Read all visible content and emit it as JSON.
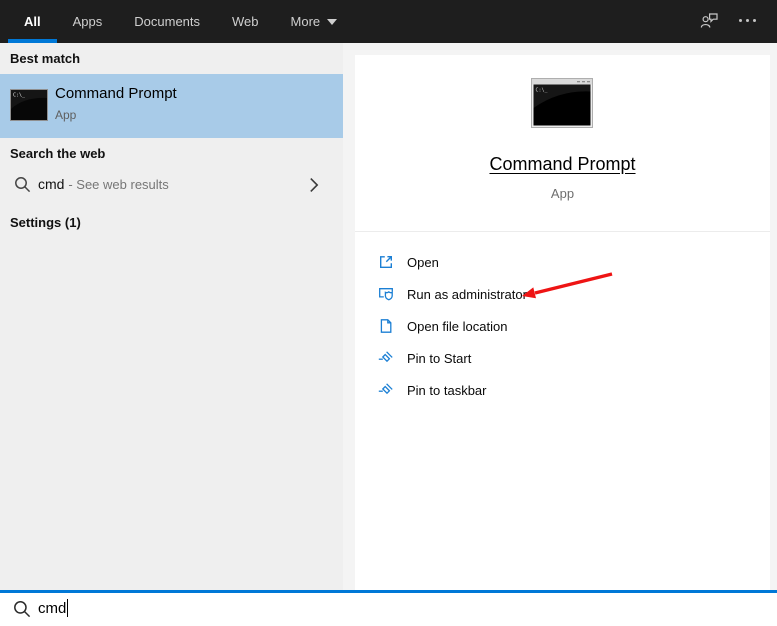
{
  "topbar": {
    "tabs": [
      {
        "label": "All",
        "active": true
      },
      {
        "label": "Apps",
        "active": false
      },
      {
        "label": "Documents",
        "active": false
      },
      {
        "label": "Web",
        "active": false
      },
      {
        "label": "More",
        "active": false,
        "has_dropdown": true
      }
    ],
    "icons": {
      "feedback": "person-chat-icon",
      "more_options": "ellipsis-icon"
    }
  },
  "left_panel": {
    "best_match": {
      "header": "Best match",
      "item": {
        "title": "Command Prompt",
        "subtitle": "App",
        "icon": "command-prompt-icon"
      }
    },
    "search_web": {
      "header": "Search the web",
      "item": {
        "query": "cmd",
        "suffix": "- See web results",
        "icon": "magnifier-icon",
        "chevron": "chevron-right-icon"
      }
    },
    "settings": {
      "header": "Settings (1)"
    }
  },
  "preview": {
    "icon": "command-prompt-window-icon",
    "icon_prompt_text": "C:\\_",
    "title": "Command Prompt",
    "subtitle": "App",
    "actions": [
      {
        "icon": "open-new-window-icon",
        "label": "Open"
      },
      {
        "icon": "run-admin-shield-icon",
        "label": "Run as administrator"
      },
      {
        "icon": "open-file-location-icon",
        "label": "Open file location"
      },
      {
        "icon": "pin-icon",
        "label": "Pin to Start"
      },
      {
        "icon": "pin-icon",
        "label": "Pin to taskbar"
      }
    ],
    "annotation": {
      "type": "red-arrow",
      "points_to": "Run as administrator"
    }
  },
  "search_bar": {
    "value": "cmd",
    "icon": "magnifier-icon"
  },
  "colors": {
    "topbar_bg": "#1e1e1e",
    "accent_blue": "#0078d7",
    "best_match_highlight": "#a8cbe8",
    "left_panel_bg": "#efefef",
    "panel_gap_bg": "#f4f4f4",
    "action_icon_blue": "#1b7fd4",
    "annotation_arrow_red": "#ee1414"
  }
}
